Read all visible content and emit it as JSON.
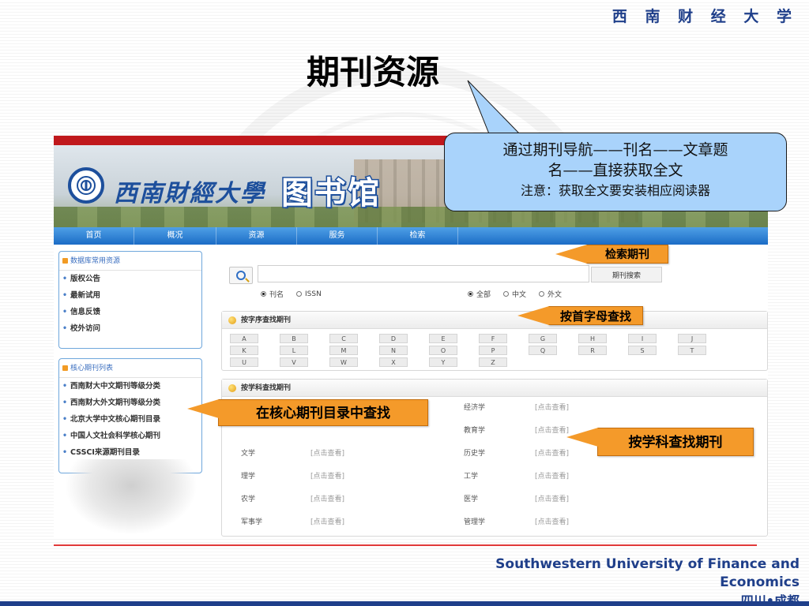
{
  "slide": {
    "university_cn": "西 南 财 经 大 学",
    "title": "期刊资源",
    "note_line1": "通过期刊导航——刊名——文章题",
    "note_line2": "名——直接获取全文",
    "note_line3": "注意：获取全文要安装相应阅读器",
    "university_en_line1": "Southwestern University of Finance and",
    "university_en_line2": "Economics",
    "city": "四川•成都"
  },
  "banner": {
    "logo_text": "西南財經大學",
    "library_text": "图书馆"
  },
  "nav": {
    "items": [
      "首页",
      "概况",
      "资源",
      "服务",
      "检索"
    ]
  },
  "sidebar": {
    "box1_title": "数据库常用资源",
    "box1_items": [
      "版权公告",
      "最新试用",
      "信息反馈",
      "校外访问"
    ],
    "box2_title": "核心期刊列表",
    "box2_items": [
      "西南财大中文期刊等级分类",
      "西南财大外文期刊等级分类",
      "北京大学中文核心期刊目录",
      "中国人文社会科学核心期刊",
      "CSSCI来源期刊目录"
    ]
  },
  "search": {
    "input_value": "",
    "button_label": "期刊搜索",
    "type_options": [
      "刊名",
      "ISSN"
    ],
    "lang_options": [
      "全部",
      "中文",
      "外文"
    ]
  },
  "alpha_panel": {
    "title": "按字序查找期刊",
    "letters": [
      "A",
      "B",
      "C",
      "D",
      "E",
      "F",
      "G",
      "H",
      "I",
      "J",
      "K",
      "L",
      "M",
      "N",
      "O",
      "P",
      "Q",
      "R",
      "S",
      "T",
      "U",
      "V",
      "W",
      "X",
      "Y",
      "Z"
    ]
  },
  "subject_panel": {
    "title": "按学科查找期刊",
    "view_label": "[点击查看]",
    "left": [
      "",
      "",
      "文学",
      "理学",
      "农学",
      "军事学"
    ],
    "right": [
      "经济学",
      "教育学",
      "历史学",
      "工学",
      "医学",
      "管理学"
    ]
  },
  "callouts": {
    "search": "检索期刊",
    "letter": "按首字母查找",
    "core": "在核心期刊目录中查找",
    "subject": "按学科查找期刊"
  },
  "colors": {
    "brand_blue": "#1f3f8a",
    "callout_orange": "#f49a2a",
    "nav_blue": "#1b6cc6",
    "accent_red": "#c0181c",
    "note_bg": "#a9d3fb"
  }
}
